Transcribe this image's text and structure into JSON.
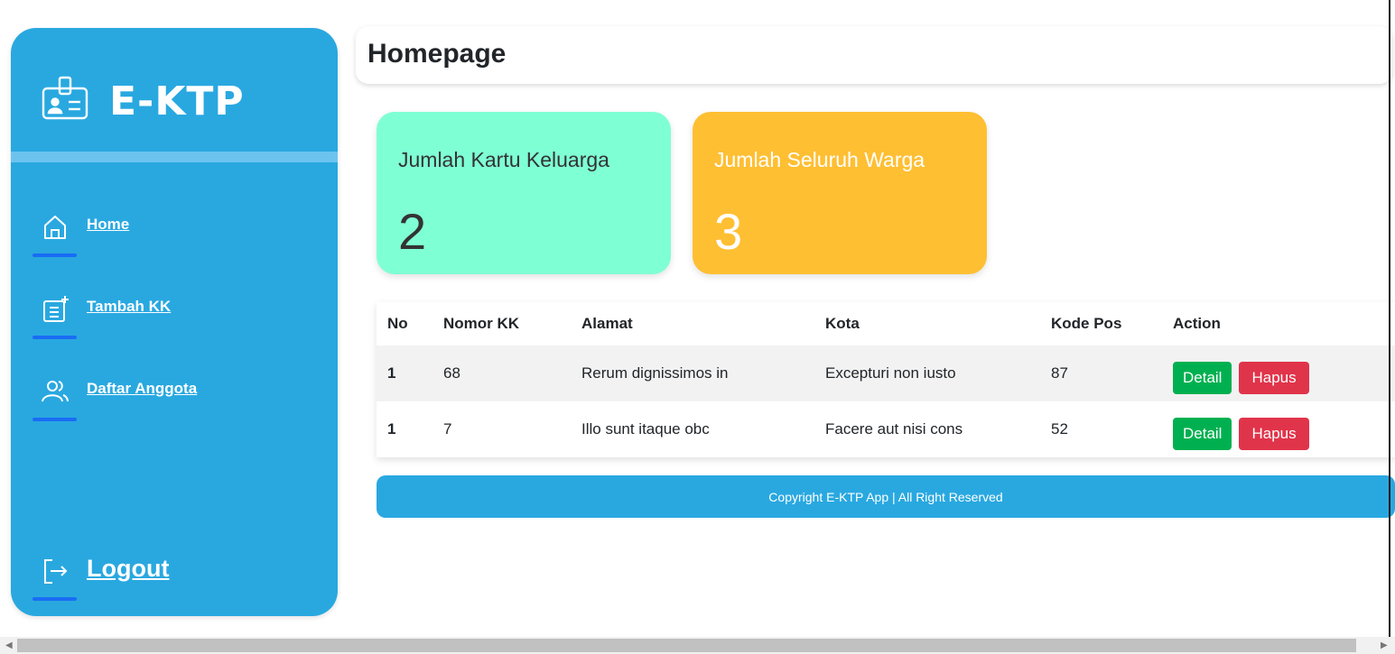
{
  "sidebar": {
    "brand": "E-KTP",
    "items": [
      {
        "label": "Home"
      },
      {
        "label": "Tambah KK"
      },
      {
        "label": "Daftar Anggota"
      }
    ],
    "logout": "Logout"
  },
  "header": {
    "title": "Homepage"
  },
  "cards": [
    {
      "title": "Jumlah Kartu Keluarga",
      "value": "2"
    },
    {
      "title": "Jumlah Seluruh Warga",
      "value": "3"
    }
  ],
  "table": {
    "headers": [
      "No",
      "Nomor KK",
      "Alamat",
      "Kota",
      "Kode Pos",
      "Action"
    ],
    "rows": [
      {
        "no": "1",
        "nomor_kk": "68",
        "alamat": "Rerum dignissimos in",
        "kota": "Excepturi non iusto",
        "kode_pos": "87",
        "detail": "Detail",
        "hapus": "Hapus"
      },
      {
        "no": "1",
        "nomor_kk": "7",
        "alamat": "Illo sunt itaque obc",
        "kota": "Facere aut nisi cons",
        "kode_pos": "52",
        "detail": "Detail",
        "hapus": "Hapus"
      }
    ]
  },
  "footer": {
    "text": "Copyright E-KTP App | All Right Reserved"
  },
  "colors": {
    "sidebar": "#29a8e0",
    "card_kk": "#7fffd4",
    "card_warga": "#ffbf33",
    "detail": "#00b050",
    "hapus": "#e0344a"
  },
  "icons": {
    "brand": "id-card-icon",
    "home": "home-icon",
    "tambah": "add-list-icon",
    "daftar": "people-icon",
    "logout": "logout-icon"
  }
}
